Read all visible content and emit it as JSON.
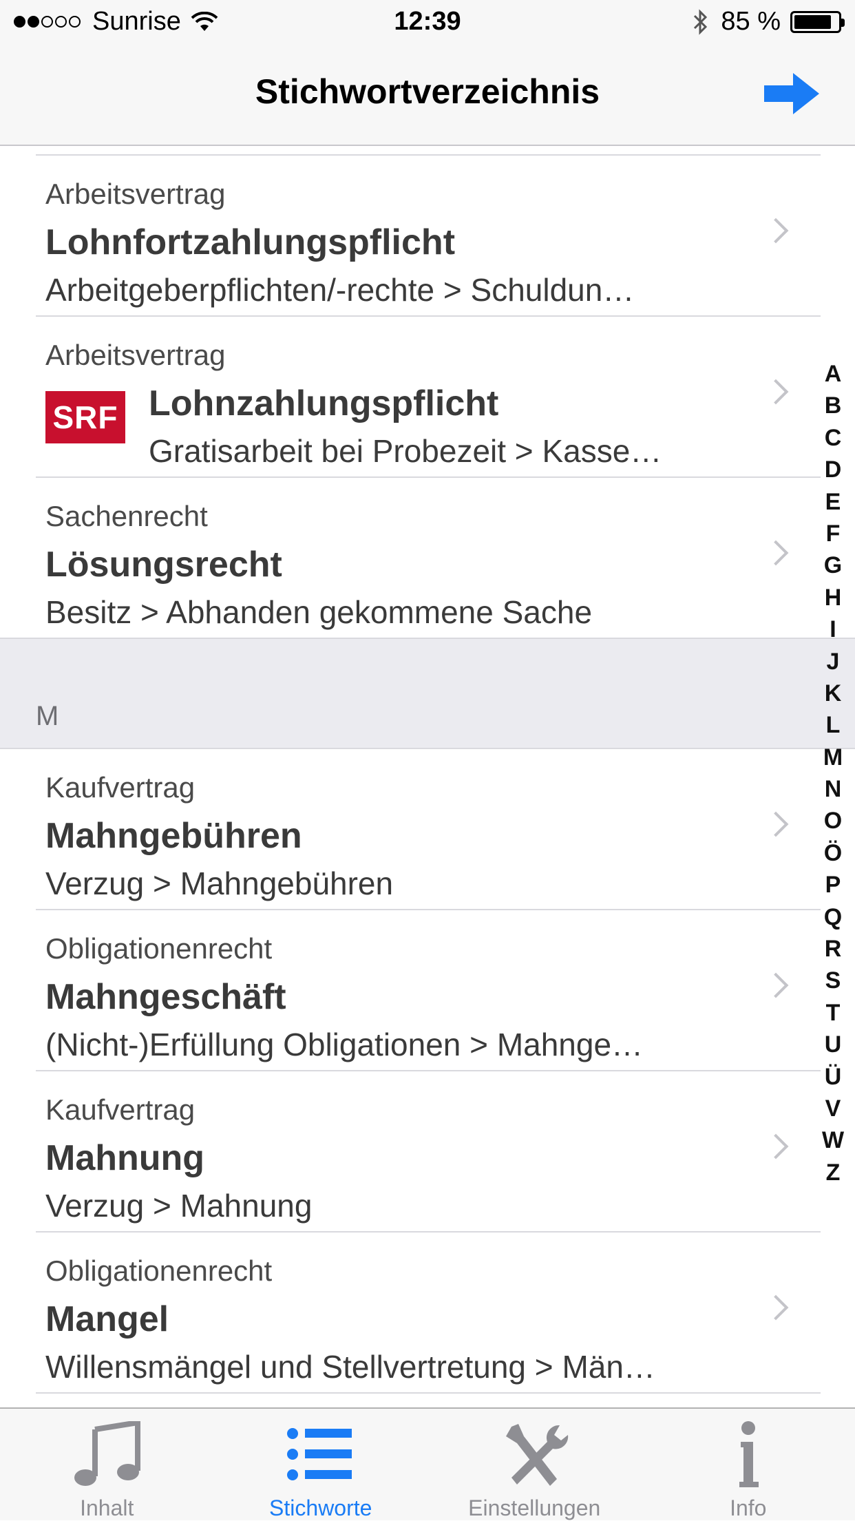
{
  "status_bar": {
    "carrier": "Sunrise",
    "time": "12:39",
    "battery": "85 %",
    "battery_level": 0.85
  },
  "nav": {
    "title": "Stichwortverzeichnis"
  },
  "colors": {
    "accent": "#1a7cf5",
    "srf_red": "#c8102e",
    "section_bg": "#ebebf0"
  },
  "rows_group1": [
    {
      "category": "Arbeitsvertrag",
      "title": "Lohnfortzahlungspflicht",
      "path": "Arbeitgeberpflichten/-rechte > Schuldun…"
    },
    {
      "category": "Arbeitsvertrag",
      "title": "Lohnzahlungspflicht",
      "path": "Gratisarbeit bei Probezeit > Kasse…",
      "logo": "SRF"
    },
    {
      "category": "Sachenrecht",
      "title": "Lösungsrecht",
      "path": "Besitz > Abhanden gekommene Sache"
    }
  ],
  "section_header": "M",
  "rows_group2": [
    {
      "category": "Kaufvertrag",
      "title": "Mahngebühren",
      "path": "Verzug > Mahngebühren"
    },
    {
      "category": "Obligationenrecht",
      "title": "Mahngeschäft",
      "path": "(Nicht-)Erfüllung Obligationen > Mahnge…"
    },
    {
      "category": "Kaufvertrag",
      "title": "Mahnung",
      "path": "Verzug > Mahnung"
    },
    {
      "category": "Obligationenrecht",
      "title": "Mangel",
      "path": "Willensmängel und Stellvertretung > Män…"
    }
  ],
  "index_letters": [
    "A",
    "B",
    "C",
    "D",
    "E",
    "F",
    "G",
    "H",
    "I",
    "J",
    "K",
    "L",
    "M",
    "N",
    "O",
    "Ö",
    "P",
    "Q",
    "R",
    "S",
    "T",
    "U",
    "Ü",
    "V",
    "W",
    "Z"
  ],
  "tabs": [
    {
      "label": "Inhalt",
      "icon": "music-note-icon"
    },
    {
      "label": "Stichworte",
      "icon": "list-icon",
      "active": true
    },
    {
      "label": "Einstellungen",
      "icon": "tools-icon"
    },
    {
      "label": "Info",
      "icon": "info-icon"
    }
  ]
}
